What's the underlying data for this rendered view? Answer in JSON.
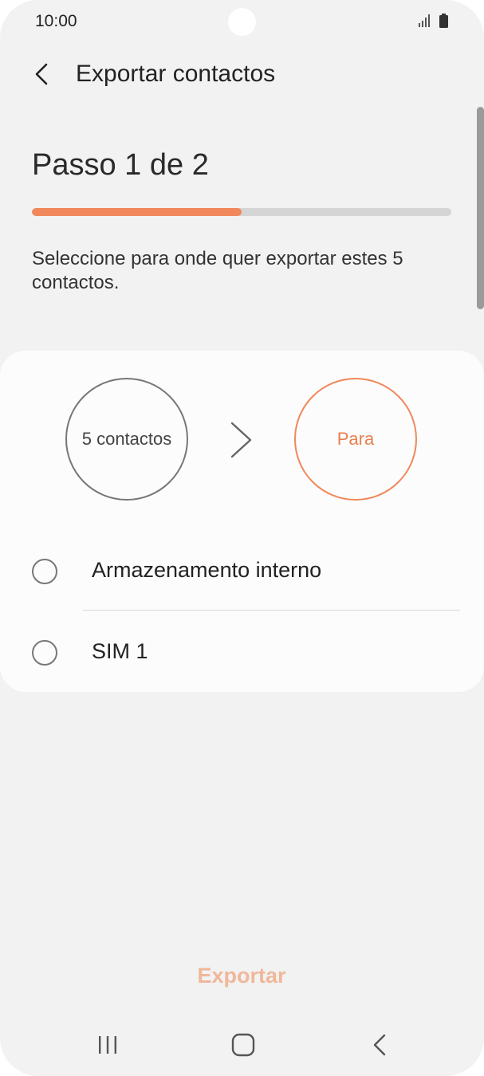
{
  "status_bar": {
    "time": "10:00",
    "icons": [
      "signal-icon",
      "battery-icon"
    ]
  },
  "header": {
    "title": "Exportar contactos",
    "back_icon": "chevron-left-icon"
  },
  "step": {
    "title": "Passo 1 de 2",
    "progress": 0.5,
    "instruction": "Seleccione para onde quer exportar estes 5 contactos."
  },
  "flow": {
    "source_label": "5 contactos",
    "destination_label": "Para"
  },
  "options": [
    {
      "label": "Armazenamento interno",
      "selected": false
    },
    {
      "label": "SIM 1",
      "selected": false
    }
  ],
  "actions": {
    "export_label": "Exportar"
  },
  "nav_bar": {
    "icons": [
      "recent-apps-icon",
      "home-icon",
      "back-icon"
    ]
  },
  "colors": {
    "accent": "#f0885c",
    "accent_disabled": "#f0b79a",
    "background": "#f2f2f2",
    "card": "#fcfcfc"
  }
}
